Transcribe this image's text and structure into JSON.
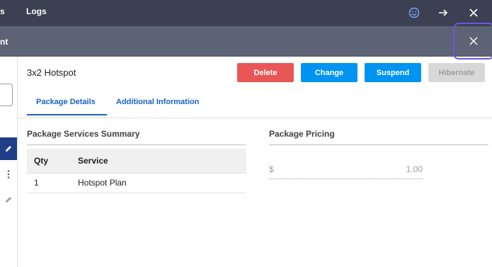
{
  "topbar": {
    "nav_partial": "s",
    "nav_logs": "Logs",
    "icons": [
      "smiley-icon",
      "arrow-right-icon",
      "close-icon"
    ]
  },
  "subbar": {
    "title_partial": "nt",
    "close_icon": "close-icon"
  },
  "package": {
    "name": "3x2 Hotspot"
  },
  "actions": {
    "delete": "Delete",
    "change": "Change",
    "suspend": "Suspend",
    "hibernate": "Hibernate"
  },
  "tabs": {
    "details": "Package Details",
    "additional": "Additional Information"
  },
  "summary": {
    "title": "Package Services Summary",
    "columns": [
      "Qty",
      "Service"
    ],
    "rows": [
      {
        "qty": "1",
        "service": "Hotspot Plan"
      }
    ]
  },
  "pricing": {
    "title": "Package Pricing",
    "currency": "$",
    "amount": "1.00"
  },
  "colors": {
    "topbar": "#3b4152",
    "subbar": "#5c6374",
    "delete": "#e95656",
    "primary": "#0094f0",
    "disabled": "#d8d8d8",
    "focus_ring": "#6f55e0",
    "selected_sidebar": "#1f3f86"
  }
}
